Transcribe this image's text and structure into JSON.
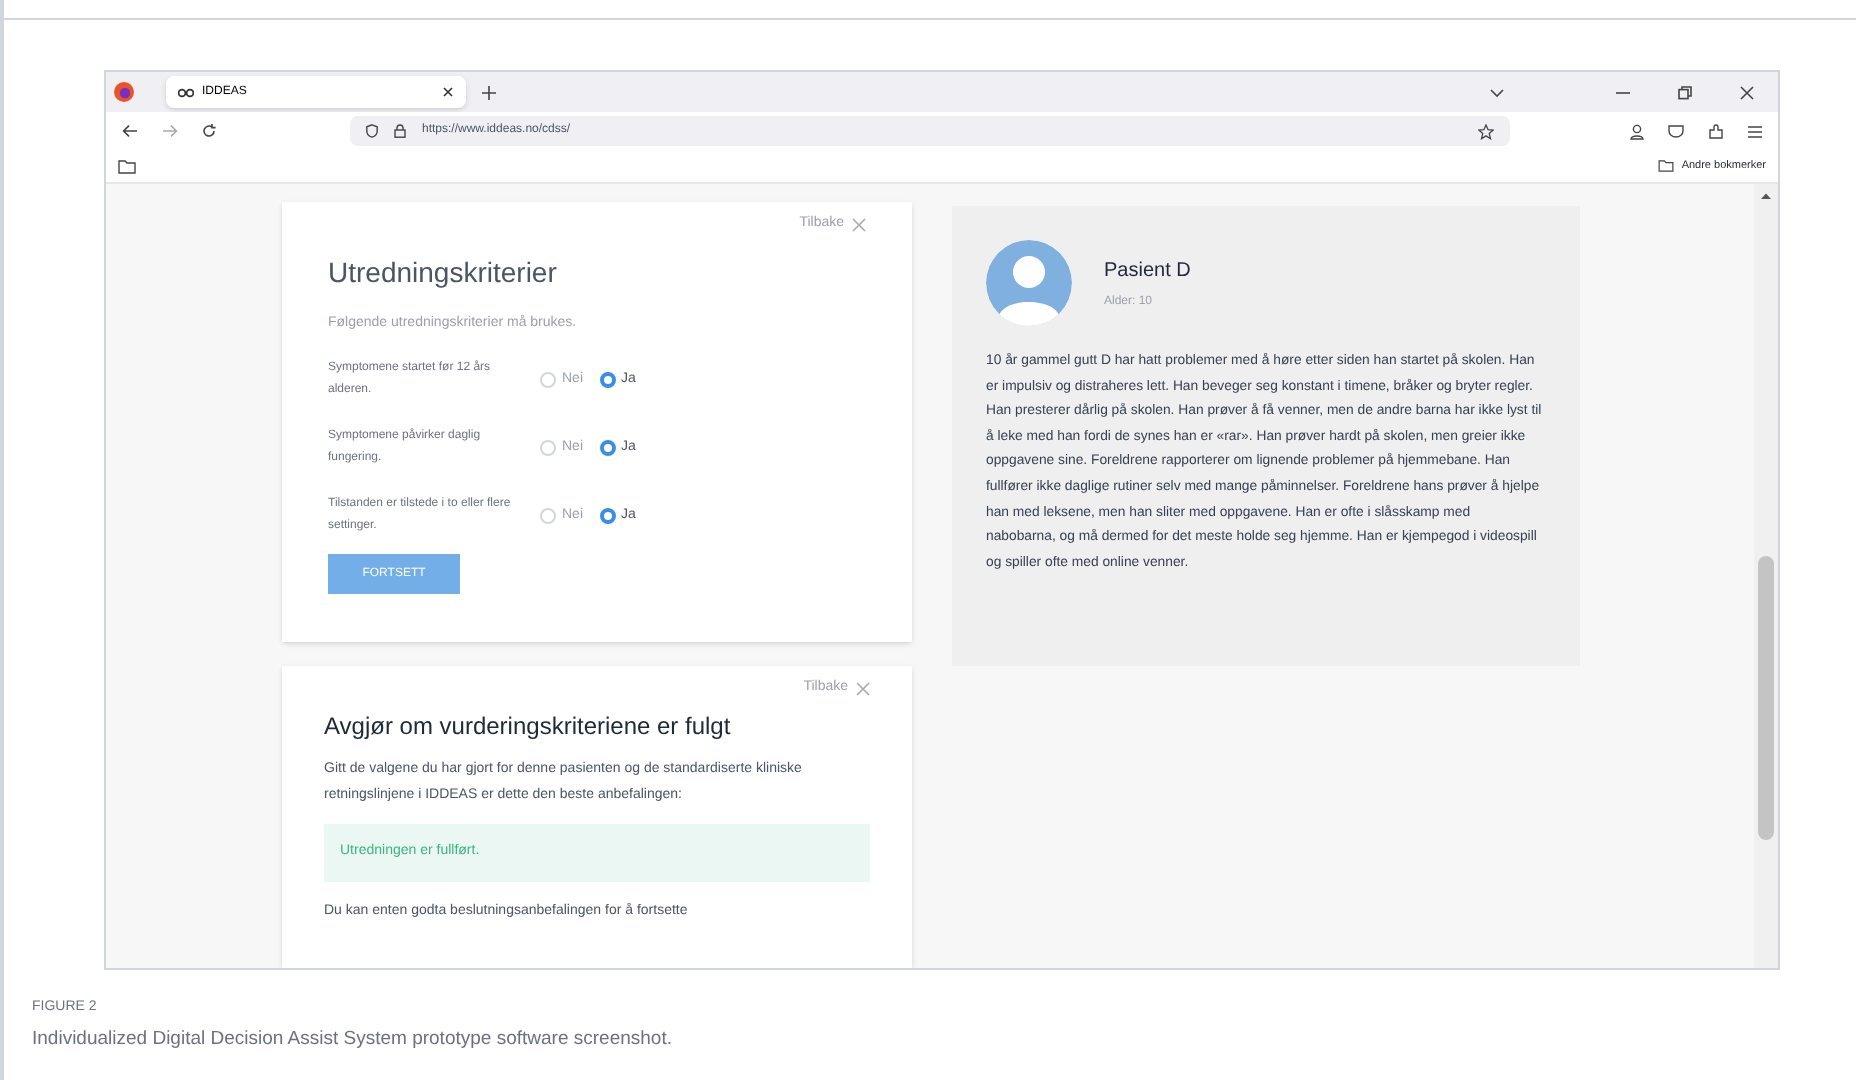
{
  "browser": {
    "tab_title": "IDDEAS",
    "url": "https://www.iddeas.no/cdss/",
    "bookmarks_folder": "Andre bokmerker"
  },
  "criteria_card": {
    "back": "Tilbake",
    "title": "Utredningskriterier",
    "subtitle": "Følgende utredningskriterier må brukes.",
    "criteria": [
      {
        "label": "Symptomene startet før 12 års alderen.",
        "options": [
          {
            "label": "Nei",
            "selected": false
          },
          {
            "label": "Ja",
            "selected": true
          }
        ]
      },
      {
        "label": "Symptomene påvirker daglig fungering.",
        "options": [
          {
            "label": "Nei",
            "selected": false
          },
          {
            "label": "Ja",
            "selected": true
          }
        ]
      },
      {
        "label": "Tilstanden er tilstede i to eller flere settinger.",
        "options": [
          {
            "label": "Nei",
            "selected": false
          },
          {
            "label": "Ja",
            "selected": true
          }
        ]
      }
    ],
    "button": "FORTSETT"
  },
  "decision_card": {
    "back": "Tilbake",
    "title": "Avgjør om vurderingskriteriene er fulgt",
    "intro": "Gitt de valgene du har gjort for denne pasienten og de standardiserte kliniske retningslinjene i IDDEAS er dette den beste anbefalingen:",
    "result": "Utredningen er fullført.",
    "footer_text": "Du kan enten godta beslutningsanbefalingen for å fortsette"
  },
  "patient": {
    "name": "Pasient D",
    "age": "Alder: 10",
    "description": "10 år gammel gutt D har hatt problemer med å høre etter siden han startet på skolen. Han er impulsiv og distraheres lett. Han beveger seg konstant i timene, bråker og bryter regler. Han presterer dårlig på skolen. Han prøver å få venner, men de andre barna har ikke lyst til å leke med han fordi de synes han er «rar». Han prøver hardt på skolen, men greier ikke oppgavene sine. Foreldrene rapporterer om lignende problemer på hjemmebane. Han fullfører ikke daglige rutiner selv med mange påminnelser. Foreldrene hans prøver å hjelpe han med leksene, men han sliter med oppgavene. Han er ofte i slåsskamp med nabobarna, og må dermed for det meste holde seg hjemme. Han er kjempegod i videospill og spiller ofte med online venner."
  },
  "caption": {
    "label": "FIGURE 2",
    "text": "Individualized Digital Decision Assist System prototype software screenshot."
  }
}
